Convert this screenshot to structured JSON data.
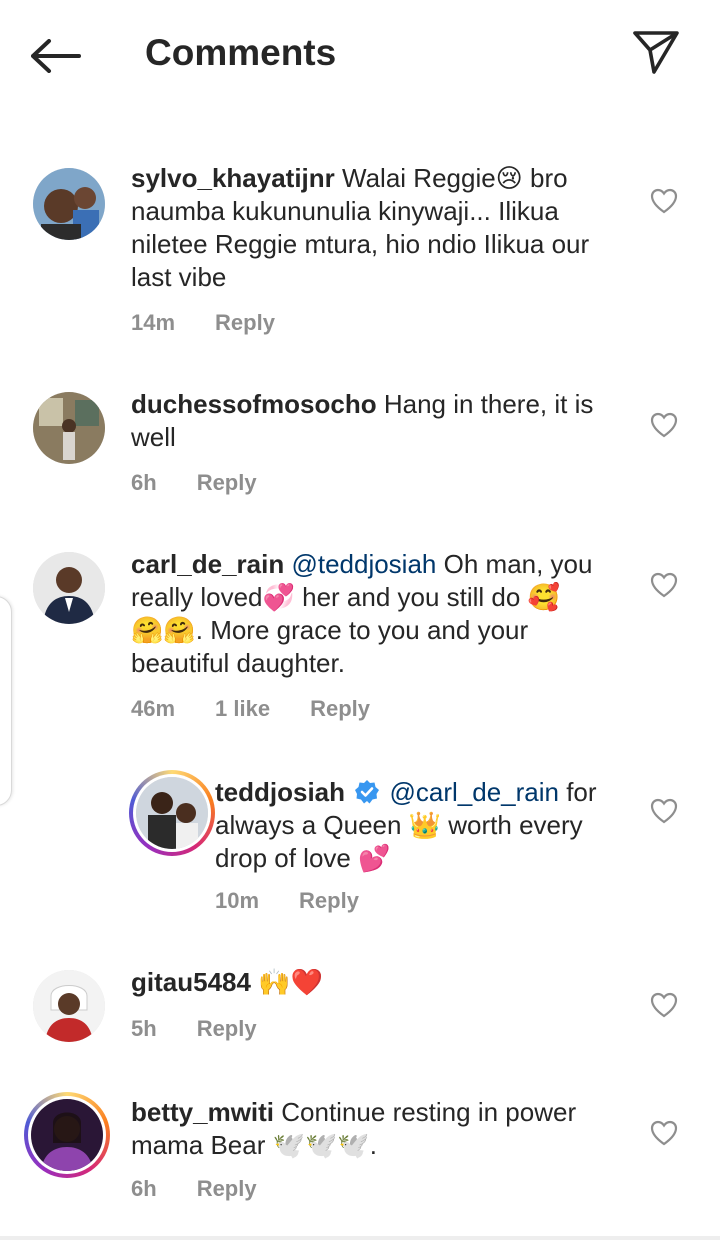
{
  "header": {
    "title": "Comments"
  },
  "comments": [
    {
      "username": "sylvo_khayatijnr",
      "text_lines": [
        "Walai Reggie😢 bro",
        "naumba kukununulia kinywaji... Ilikua",
        "niletee Reggie mtura, hio ndio Ilikua our",
        "last vibe"
      ],
      "time": "14m",
      "reply": "Reply"
    },
    {
      "username": "duchessofmosocho",
      "text_lines": [
        "Hang in there, it is",
        "well"
      ],
      "time": "6h",
      "reply": "Reply"
    },
    {
      "username": "carl_de_rain",
      "mention": "@teddjosiah",
      "text_lines": [
        "Oh man, you",
        "really loved💞 her and you still do 🥰",
        "🤗🤗. More grace to you and your",
        "beautiful daughter."
      ],
      "time": "46m",
      "likes": "1 like",
      "reply": "Reply"
    },
    {
      "username": "teddjosiah",
      "mention": "@carl_de_rain",
      "text_lines": [
        "for",
        "always a Queen 👑 worth every",
        "drop of love 💕"
      ],
      "time": "10m",
      "reply": "Reply"
    },
    {
      "username": "gitau5484",
      "text_lines": [
        "🙌❤️"
      ],
      "time": "5h",
      "reply": "Reply"
    },
    {
      "username": "betty_mwiti",
      "text_lines": [
        "Continue resting in power",
        "mama Bear 🕊️🕊️🕊️."
      ],
      "time": "6h",
      "reply": "Reply"
    }
  ],
  "colors": {
    "text": "#262626",
    "meta": "#8e8e8e",
    "mention": "#00376b",
    "verified": "#3897f0"
  }
}
